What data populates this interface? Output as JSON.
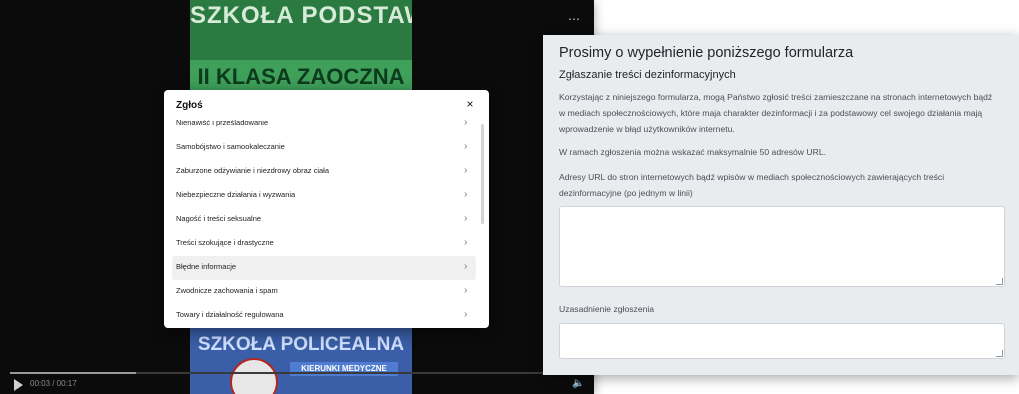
{
  "video": {
    "poster_line_1": "SZKOŁA PODSTAWOWA",
    "poster_line_2": "II KLASA ZAOCZNA",
    "poster_line_3": "SZKOŁA POLICEALNA",
    "poster_line_4": "KIERUNKI MEDYCZNE",
    "more_icon": "⋯",
    "time": "00:03 / 00:17",
    "progress": 0.22
  },
  "modal": {
    "title": "Zgłoś",
    "close_icon": "×",
    "items": [
      {
        "label": "Nienawiść i prześladowanie"
      },
      {
        "label": "Samobójstwo i samookaleczanie"
      },
      {
        "label": "Zaburzone odżywianie i niezdrowy obraz ciała"
      },
      {
        "label": "Niebezpieczne działania i wyzwania"
      },
      {
        "label": "Nagość i treści seksualne"
      },
      {
        "label": "Treści szokujące i drastyczne"
      },
      {
        "label": "Błędne informacje",
        "active": true
      },
      {
        "label": "Zwodnicze zachowania i spam"
      },
      {
        "label": "Towary i działalność regulowana"
      }
    ]
  },
  "form": {
    "title": "Prosimy o wypełnienie poniższego formularza",
    "subtitle": "Zgłaszanie treści dezinformacyjnych",
    "description": "Korzystając z niniejszego formularza, mogą Państwo zgłosić treści zamieszczane na stronach internetowych bądź w mediach społecznościowych, które maja charakter dezinformacji i za podstawowy cel swojego działania mają wprowadzenie w błąd użytkowników internetu.",
    "note": "W ramach zgłoszenia można wskazać maksymalnie 50 adresów URL.",
    "url_label": "Adresy URL do stron internetowych bądź wpisów w mediach społecznościowych zawierających treści dezinformacyjne (po jednym w linii)",
    "url_value": "",
    "justification_label": "Uzasadnienie zgłoszenia",
    "justification_value": ""
  }
}
